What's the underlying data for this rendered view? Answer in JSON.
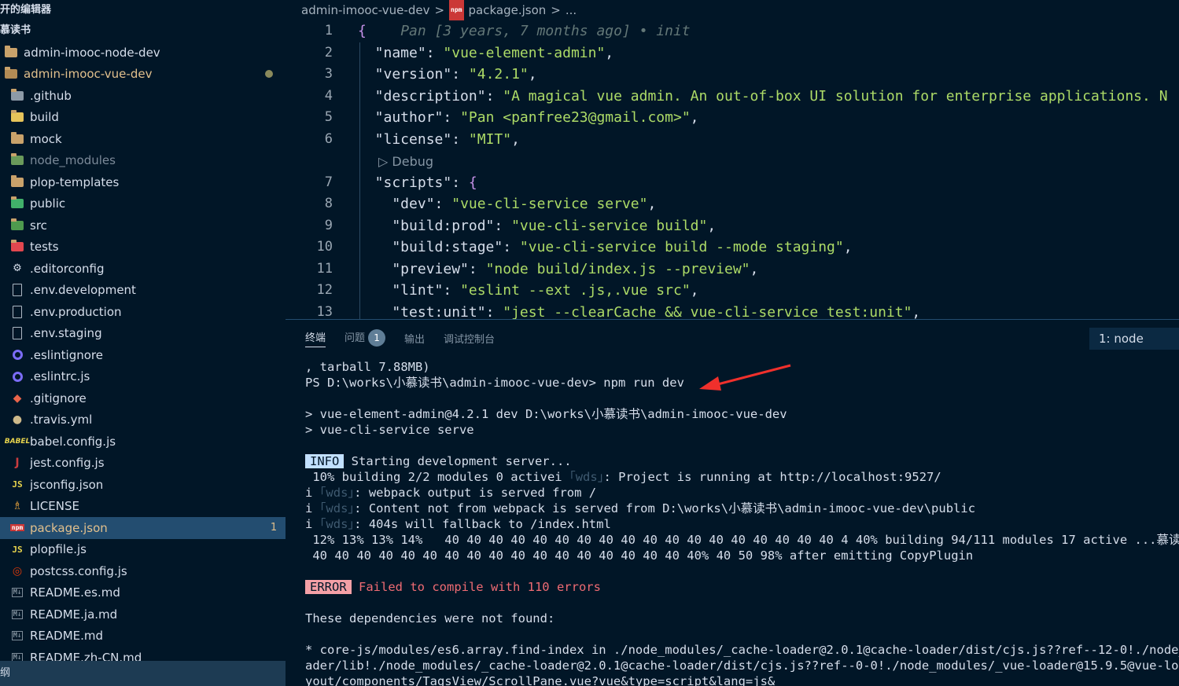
{
  "sidebar": {
    "section_editors": "开的编辑器",
    "section_workspace": "慕读书",
    "items": [
      {
        "label": "admin-imooc-node-dev",
        "icon": "folder-icon",
        "level": 0,
        "state": "normal"
      },
      {
        "label": "admin-imooc-vue-dev",
        "icon": "folder-open-icon",
        "level": 0,
        "state": "modified-folder"
      },
      {
        "label": ".github",
        "icon": "github-folder-icon",
        "level": 1,
        "state": "normal"
      },
      {
        "label": "build",
        "icon": "build-folder-icon",
        "level": 1,
        "state": "normal"
      },
      {
        "label": "mock",
        "icon": "folder-icon",
        "level": 1,
        "state": "normal"
      },
      {
        "label": "node_modules",
        "icon": "node-folder-icon",
        "level": 1,
        "state": "dim"
      },
      {
        "label": "plop-templates",
        "icon": "folder-icon",
        "level": 1,
        "state": "normal"
      },
      {
        "label": "public",
        "icon": "public-folder-icon",
        "level": 1,
        "state": "normal"
      },
      {
        "label": "src",
        "icon": "src-folder-icon",
        "level": 1,
        "state": "normal"
      },
      {
        "label": "tests",
        "icon": "tests-folder-icon",
        "level": 1,
        "state": "normal"
      },
      {
        "label": ".editorconfig",
        "icon": "editorconfig-icon",
        "level": 1,
        "state": "normal"
      },
      {
        "label": ".env.development",
        "icon": "file-icon",
        "level": 1,
        "state": "normal"
      },
      {
        "label": ".env.production",
        "icon": "file-icon",
        "level": 1,
        "state": "normal"
      },
      {
        "label": ".env.staging",
        "icon": "file-icon",
        "level": 1,
        "state": "normal"
      },
      {
        "label": ".eslintignore",
        "icon": "eslint-icon",
        "level": 1,
        "state": "normal"
      },
      {
        "label": ".eslintrc.js",
        "icon": "eslint-icon",
        "level": 1,
        "state": "normal"
      },
      {
        "label": ".gitignore",
        "icon": "git-icon",
        "level": 1,
        "state": "normal"
      },
      {
        "label": ".travis.yml",
        "icon": "travis-icon",
        "level": 1,
        "state": "normal"
      },
      {
        "label": "babel.config.js",
        "icon": "babel-icon",
        "level": 1,
        "state": "normal"
      },
      {
        "label": "jest.config.js",
        "icon": "jest-icon",
        "level": 1,
        "state": "normal"
      },
      {
        "label": "jsconfig.json",
        "icon": "js-icon",
        "level": 1,
        "state": "normal"
      },
      {
        "label": "LICENSE",
        "icon": "license-icon",
        "level": 1,
        "state": "normal"
      },
      {
        "label": "package.json",
        "icon": "npm-icon",
        "level": 1,
        "state": "selected",
        "badge": "1"
      },
      {
        "label": "plopfile.js",
        "icon": "js-icon",
        "level": 1,
        "state": "normal"
      },
      {
        "label": "postcss.config.js",
        "icon": "postcss-icon",
        "level": 1,
        "state": "normal"
      },
      {
        "label": "README.es.md",
        "icon": "markdown-icon",
        "level": 1,
        "state": "normal"
      },
      {
        "label": "README.ja.md",
        "icon": "markdown-icon",
        "level": 1,
        "state": "normal"
      },
      {
        "label": "README.md",
        "icon": "markdown-icon",
        "level": 1,
        "state": "normal"
      },
      {
        "label": "README.zh-CN.md",
        "icon": "markdown-icon",
        "level": 1,
        "state": "normal"
      }
    ],
    "status_text": "纲"
  },
  "editor": {
    "breadcrumbs": [
      "admin-imooc-vue-dev",
      ">",
      "package.json",
      ">",
      "..."
    ],
    "blame": "Pan [3 years, 7 months ago] • init",
    "codelens": "Debug",
    "lines": [
      {
        "n": "1",
        "parts": [
          [
            "br",
            "{"
          ],
          [
            "blame",
            "    Pan [3 years, 7 months ago] • init"
          ]
        ]
      },
      {
        "n": "2",
        "parts": [
          [
            "k",
            "  \"name\""
          ],
          [
            "p",
            ": "
          ],
          [
            "s",
            "\"vue-element-admin\""
          ],
          [
            "p",
            ","
          ]
        ]
      },
      {
        "n": "3",
        "parts": [
          [
            "k",
            "  \"version\""
          ],
          [
            "p",
            ": "
          ],
          [
            "s",
            "\"4.2.1\""
          ],
          [
            "p",
            ","
          ]
        ]
      },
      {
        "n": "4",
        "parts": [
          [
            "k",
            "  \"description\""
          ],
          [
            "p",
            ": "
          ],
          [
            "s",
            "\"A magical vue admin. An out-of-box UI solution for enterprise applications. N"
          ]
        ]
      },
      {
        "n": "5",
        "parts": [
          [
            "k",
            "  \"author\""
          ],
          [
            "p",
            ": "
          ],
          [
            "s",
            "\"Pan <panfree23@gmail.com>\""
          ],
          [
            "p",
            ","
          ]
        ]
      },
      {
        "n": "6",
        "parts": [
          [
            "k",
            "  \"license\""
          ],
          [
            "p",
            ": "
          ],
          [
            "s",
            "\"MIT\""
          ],
          [
            "p",
            ","
          ]
        ]
      },
      {
        "n": "7",
        "parts": [
          [
            "k",
            "  \"scripts\""
          ],
          [
            "p",
            ": "
          ],
          [
            "br",
            "{"
          ]
        ]
      },
      {
        "n": "8",
        "parts": [
          [
            "k",
            "    \"dev\""
          ],
          [
            "p",
            ": "
          ],
          [
            "s",
            "\"vue-cli-service serve\""
          ],
          [
            "p",
            ","
          ]
        ]
      },
      {
        "n": "9",
        "parts": [
          [
            "k",
            "    \"build:prod\""
          ],
          [
            "p",
            ": "
          ],
          [
            "s",
            "\"vue-cli-service build\""
          ],
          [
            "p",
            ","
          ]
        ]
      },
      {
        "n": "10",
        "parts": [
          [
            "k",
            "    \"build:stage\""
          ],
          [
            "p",
            ": "
          ],
          [
            "s",
            "\"vue-cli-service build --mode staging\""
          ],
          [
            "p",
            ","
          ]
        ]
      },
      {
        "n": "11",
        "parts": [
          [
            "k",
            "    \"preview\""
          ],
          [
            "p",
            ": "
          ],
          [
            "s",
            "\"node build/index.js --preview\""
          ],
          [
            "p",
            ","
          ]
        ]
      },
      {
        "n": "12",
        "parts": [
          [
            "k",
            "    \"lint\""
          ],
          [
            "p",
            ": "
          ],
          [
            "s",
            "\"eslint --ext .js,.vue src\""
          ],
          [
            "p",
            ","
          ]
        ]
      },
      {
        "n": "13",
        "parts": [
          [
            "k",
            "    \"test:unit\""
          ],
          [
            "p",
            ": "
          ],
          [
            "s",
            "\"jest --clearCache && vue-cli-service test:unit\""
          ],
          [
            "p",
            ","
          ]
        ]
      }
    ]
  },
  "panel": {
    "tabs": [
      {
        "label": "终端",
        "active": true
      },
      {
        "label": "问题",
        "active": false,
        "badge": "1"
      },
      {
        "label": "输出",
        "active": false
      },
      {
        "label": "调试控制台",
        "active": false
      }
    ],
    "terminal_select": "1: node",
    "terminal_lines": [
      [
        [
          "t",
          ", tarball 7.88MB)"
        ]
      ],
      [
        [
          "t",
          "PS D:\\works\\小慕读书\\admin-imooc-vue-dev> npm run dev"
        ]
      ],
      [
        [
          "t",
          ""
        ]
      ],
      [
        [
          "t",
          "> vue-element-admin@4.2.1 dev D:\\works\\小慕读书\\admin-imooc-vue-dev"
        ]
      ],
      [
        [
          "t",
          "> vue-cli-service serve"
        ]
      ],
      [
        [
          "t",
          ""
        ]
      ],
      [
        [
          "info",
          "INFO"
        ],
        [
          "t",
          " Starting development server..."
        ]
      ],
      [
        [
          "t",
          " 10% building 2/2 modules 0 activei "
        ],
        [
          "wds",
          "｢wds｣"
        ],
        [
          "t",
          ": Project is running at http://localhost:9527/"
        ]
      ],
      [
        [
          "t",
          "i "
        ],
        [
          "wds",
          "｢wds｣"
        ],
        [
          "t",
          ": webpack output is served from /"
        ]
      ],
      [
        [
          "t",
          "i "
        ],
        [
          "wds",
          "｢wds｣"
        ],
        [
          "t",
          ": Content not from webpack is served from D:\\works\\小慕读书\\admin-imooc-vue-dev\\public"
        ]
      ],
      [
        [
          "t",
          "i "
        ],
        [
          "wds",
          "｢wds｣"
        ],
        [
          "t",
          ": 404s will fallback to /index.html"
        ]
      ],
      [
        [
          "t",
          " 12% 13% 13% 14%   40 40 40 40 40 40 40 40 40 40 40 40 40 40 40 40 40 40 4 40% building 94/111 modules 17 active ...慕读书\\a"
        ]
      ],
      [
        [
          "t",
          " 40 40 40 40 40 40 40 40 40 40 40 40 40 40 40 40 40 40% 40 50 98% after emitting CopyPlugin"
        ]
      ],
      [
        [
          "t",
          ""
        ]
      ],
      [
        [
          "error",
          "ERROR"
        ],
        [
          "err",
          " Failed to compile with 110 errors"
        ]
      ],
      [
        [
          "t",
          ""
        ]
      ],
      [
        [
          "t",
          "These dependencies were not found:"
        ]
      ],
      [
        [
          "t",
          ""
        ]
      ],
      [
        [
          "t",
          "* core-js/modules/es6.array.find-index in ./node_modules/_cache-loader@2.0.1@cache-loader/dist/cjs.js??ref--12-0!./node_modu"
        ]
      ],
      [
        [
          "t",
          "ader/lib!./node_modules/_cache-loader@2.0.1@cache-loader/dist/cjs.js??ref--0-0!./node_modules/_vue-loader@15.9.5@vue-loader/"
        ]
      ],
      [
        [
          "t",
          "yout/components/TagsView/ScrollPane.vue?vue&type=script&lang=js&"
        ]
      ]
    ]
  }
}
